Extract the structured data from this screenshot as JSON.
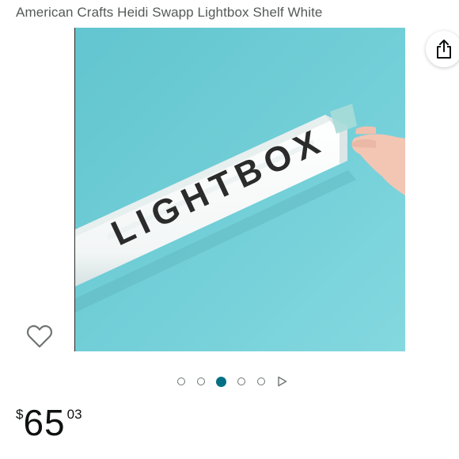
{
  "product": {
    "title": "American Crafts Heidi Swapp Lightbox Shelf White",
    "image": {
      "box_text": "LIGHTBOX",
      "background_color": "#71CDD6"
    }
  },
  "actions": {
    "share_icon": "share-icon",
    "wishlist_icon": "heart-outline-icon"
  },
  "carousel": {
    "total_images": 5,
    "active_index": 2,
    "has_video": true,
    "video_icon": "play-icon",
    "active_color": "#007185"
  },
  "price": {
    "currency_symbol": "$",
    "whole": "65",
    "fraction": "03"
  }
}
